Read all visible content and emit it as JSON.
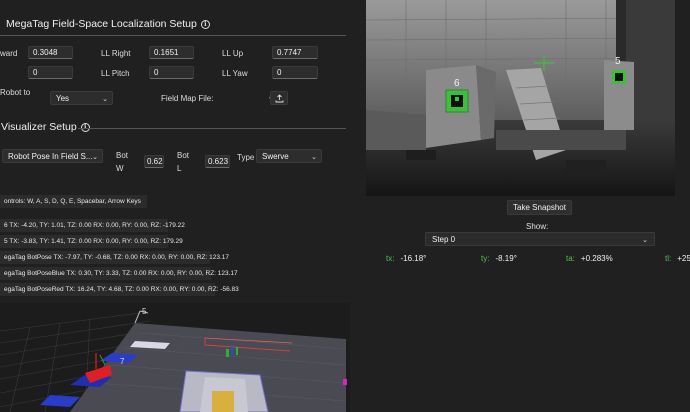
{
  "megatag": {
    "title": "MegaTag Field-Space Localization Setup",
    "fields": {
      "forward_label": "ward",
      "forward_value": "0.3048",
      "ll_right_label": "LL Right",
      "ll_right_value": "0.1651",
      "ll_up_label": "LL Up",
      "ll_up_value": "0.7747",
      "side_value": "0",
      "ll_pitch_label": "LL Pitch",
      "ll_pitch_value": "0",
      "ll_yaw_label": "LL Yaw",
      "ll_yaw_value": "0",
      "robot_to_label": "Robot to",
      "robot_to_value": "Yes",
      "field_map_label": "Field Map File:"
    }
  },
  "visualizer": {
    "title": "Visualizer Setup",
    "view_select": "Robot Pose In Field S...",
    "bot_w_label_1": "Bot",
    "bot_w_label_2": "W",
    "bot_w_value": "0.623",
    "bot_l_label_1": "Bot",
    "bot_l_label_2": "L",
    "bot_l_value": "0.623",
    "type_label": "Type",
    "type_value": "Swerve",
    "controls_text": "ontrols: W, A, S, D, Q, E, Spacebar, Arrow Keys",
    "info_rows": [
      "6 TX: -4.20, TY: 1.01, TZ: 0.00 RX: 0.00, RY: 0.00, RZ: -179.22",
      "5 TX: -3.83, TY: 1.41, TZ: 0.00 RX: 0.00, RY: 0.00, RZ: 179.29",
      "egaTag BotPose TX: -7.97, TY: -0.68, TZ: 0.00 RX: 0.00, RY: 0.00, RZ: 123.17",
      "egaTag BotPoseBlue TX: 0.30, TY: 3.33, TZ: 0.00 RX: 0.00, RY: 0.00, RZ: 123.17",
      "egaTag BotPoseRed TX: 16.24, TY: 4.68, TZ: 0.00 RX: 0.00, RY: 0.00, RZ: -56.83"
    ],
    "scene_label_5": "5",
    "scene_label_7": "7"
  },
  "camera": {
    "tag_left_id": "6",
    "tag_right_id": "5",
    "snapshot_label": "Take Snapshot",
    "show_label": "Show:",
    "step_value": "Step 0"
  },
  "metrics": [
    {
      "key": "tx:",
      "value": "-16.18°"
    },
    {
      "key": "ty:",
      "value": "-8.19°"
    },
    {
      "key": "ta:",
      "value": "+0.283%"
    },
    {
      "key": "tl:",
      "value": "+25."
    }
  ],
  "colors": {
    "accent_green": "#4ec24e",
    "background": "#202020"
  }
}
